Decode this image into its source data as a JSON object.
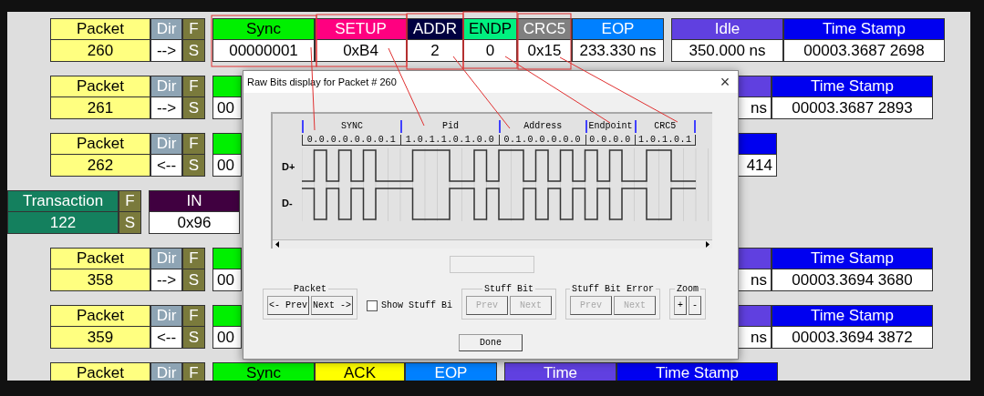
{
  "rows": [
    {
      "kind": "packet",
      "segments": [
        [
          {
            "kind": "packet",
            "header": "Packet",
            "value": "260"
          },
          {
            "kind": "dir",
            "header": "Dir",
            "value": "-->"
          },
          {
            "kind": "flag",
            "header": "F",
            "value": "S"
          }
        ],
        [
          {
            "kind": "sync",
            "header": "Sync",
            "value": "00000001"
          },
          {
            "kind": "setup",
            "header": "SETUP",
            "value": "0xB4"
          },
          {
            "kind": "addr",
            "header": "ADDR",
            "value": "2"
          },
          {
            "kind": "endp",
            "header": "ENDP",
            "value": "0"
          },
          {
            "kind": "crc5",
            "header": "CRC5",
            "value": "0x15"
          },
          {
            "kind": "eop",
            "header": "EOP",
            "value": "233.330 ns"
          }
        ],
        [
          {
            "kind": "idle",
            "header": "Idle",
            "value": "350.000 ns"
          },
          {
            "kind": "timestamp",
            "header": "Time Stamp",
            "value": "00003.3687 2698"
          }
        ]
      ]
    },
    {
      "kind": "packet",
      "segments": [
        [
          {
            "kind": "packet",
            "header": "Packet",
            "value": "261"
          },
          {
            "kind": "dir",
            "header": "Dir",
            "value": "-->"
          },
          {
            "kind": "flag",
            "header": "F",
            "value": "S"
          }
        ],
        [
          {
            "kind": "sync_part",
            "value": "00"
          }
        ]
      ],
      "right": [
        {
          "kind": "idle_part",
          "value": "ns"
        },
        {
          "kind": "timestamp",
          "header": "Time Stamp",
          "value": "00003.3687 2893"
        }
      ]
    },
    {
      "kind": "packet",
      "segments": [
        [
          {
            "kind": "packet",
            "header": "Packet",
            "value": "262"
          },
          {
            "kind": "dir",
            "header": "Dir",
            "value": "<--"
          },
          {
            "kind": "flag",
            "header": "F",
            "value": "S"
          }
        ],
        [
          {
            "kind": "sync_part",
            "value": "00"
          }
        ]
      ],
      "right": [
        {
          "kind": "timestamp_part",
          "value": "414"
        }
      ]
    },
    {
      "kind": "transaction",
      "segments": [
        [
          {
            "kind": "transaction",
            "header": "Transaction",
            "value": "122"
          },
          {
            "kind": "flag",
            "header": "F",
            "value": "S"
          }
        ],
        [
          {
            "kind": "in",
            "header": "IN",
            "value": "0x96"
          }
        ]
      ]
    },
    {
      "kind": "packet",
      "segments": [
        [
          {
            "kind": "packet",
            "header": "Packet",
            "value": "358"
          },
          {
            "kind": "dir",
            "header": "Dir",
            "value": "-->"
          },
          {
            "kind": "flag",
            "header": "F",
            "value": "S"
          }
        ],
        [
          {
            "kind": "sync_part",
            "value": "00"
          }
        ]
      ],
      "right": [
        {
          "kind": "idle_part",
          "value": "ns"
        },
        {
          "kind": "timestamp",
          "header": "Time Stamp",
          "value": "00003.3694 3680"
        }
      ]
    },
    {
      "kind": "packet",
      "segments": [
        [
          {
            "kind": "packet",
            "header": "Packet",
            "value": "359"
          },
          {
            "kind": "dir",
            "header": "Dir",
            "value": "<--"
          },
          {
            "kind": "flag",
            "header": "F",
            "value": "S"
          }
        ],
        [
          {
            "kind": "sync_part",
            "value": "00"
          }
        ]
      ],
      "right": [
        {
          "kind": "idle_part",
          "value": "ns"
        },
        {
          "kind": "timestamp",
          "header": "Time Stamp",
          "value": "00003.3694 3872"
        }
      ]
    },
    {
      "kind": "packet",
      "segments": [
        [
          {
            "kind": "packet",
            "header": "Packet"
          },
          {
            "kind": "dir",
            "header": "Dir"
          },
          {
            "kind": "flag",
            "header": "F"
          }
        ],
        [
          {
            "kind": "sync",
            "header": "Sync"
          },
          {
            "kind": "ack",
            "header": "ACK"
          },
          {
            "kind": "eop",
            "header": "EOP"
          }
        ],
        [
          {
            "kind": "idle",
            "header": "Time"
          },
          {
            "kind": "timestamp",
            "header": "Time Stamp"
          }
        ]
      ]
    }
  ],
  "dialog": {
    "title": "Raw Bits display for Packet # 260",
    "close": "×",
    "fields": [
      {
        "label": "SYNC",
        "bits": "0.0.0.0.0.0.0.1"
      },
      {
        "label": "Pid",
        "bits": "1.0.1.1.0.1.0.0"
      },
      {
        "label": "Address",
        "bits": "0.1.0.0.0.0.0"
      },
      {
        "label": "Endpoint",
        "bits": "0.0.0.0"
      },
      {
        "label": "CRC5",
        "bits": "1.0.1.0.1"
      }
    ],
    "lines": [
      {
        "label": "D+"
      },
      {
        "label": "D-"
      }
    ],
    "controls": [
      {
        "kind": "group",
        "legend": "Packet",
        "buttons": [
          {
            "label": "<- Prev",
            "disabled": false
          },
          {
            "label": "Next ->",
            "disabled": false
          }
        ]
      },
      {
        "kind": "checkbox",
        "label": "Show Stuff Bi",
        "checked": false
      },
      {
        "kind": "group",
        "legend": "Stuff Bit",
        "buttons": [
          {
            "label": "Prev",
            "disabled": true
          },
          {
            "label": "Next",
            "disabled": true
          }
        ]
      },
      {
        "kind": "group",
        "legend": "Stuff Bit Error",
        "buttons": [
          {
            "label": "Prev",
            "disabled": true
          },
          {
            "label": "Next",
            "disabled": true
          }
        ]
      },
      {
        "kind": "group",
        "legend": "Zoom",
        "buttons": [
          {
            "label": "+",
            "disabled": false
          },
          {
            "label": "-",
            "disabled": false
          }
        ]
      }
    ],
    "done": "Done"
  }
}
